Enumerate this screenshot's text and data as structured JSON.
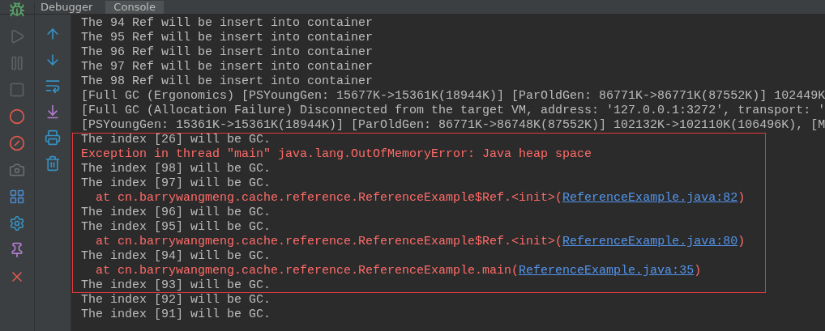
{
  "tabs": [
    {
      "label": "Debugger",
      "selected": false
    },
    {
      "label": "Console",
      "selected": true
    }
  ],
  "console": {
    "lines": [
      {
        "kind": "output",
        "text": "The 94 Ref will be insert into container"
      },
      {
        "kind": "output",
        "text": "The 95 Ref will be insert into container"
      },
      {
        "kind": "output",
        "text": "The 96 Ref will be insert into container"
      },
      {
        "kind": "output",
        "text": "The 97 Ref will be insert into container"
      },
      {
        "kind": "output",
        "text": "The 98 Ref will be insert into container"
      },
      {
        "kind": "output",
        "text": "[Full GC (Ergonomics) [PSYoungGen: 15677K->15361K(18944K)] [ParOldGen: 86771K->86771K(87552K)] 102449K"
      },
      {
        "kind": "output",
        "text": "[Full GC (Allocation Failure) Disconnected from the target VM, address: '127.0.0.1:3272', transport: '"
      },
      {
        "kind": "output",
        "text": "[PSYoungGen: 15361K->15361K(18944K)] [ParOldGen: 86771K->86748K(87552K)] 102132K->102110K(106496K), [M"
      },
      {
        "kind": "output",
        "text": "The index [26] will be GC."
      },
      {
        "kind": "error",
        "text": "Exception in thread \"main\" java.lang.OutOfMemoryError: Java heap space"
      },
      {
        "kind": "output",
        "text": "The index [98] will be GC."
      },
      {
        "kind": "output",
        "text": "The index [97] will be GC."
      },
      {
        "kind": "error",
        "text": "  at cn.barrywangmeng.cache.reference.ReferenceExample$Ref.<init>(",
        "link": "ReferenceExample.java:82",
        "after": ")"
      },
      {
        "kind": "output",
        "text": "The index [96] will be GC."
      },
      {
        "kind": "output",
        "text": "The index [95] will be GC."
      },
      {
        "kind": "error",
        "text": "  at cn.barrywangmeng.cache.reference.ReferenceExample$Ref.<init>(",
        "link": "ReferenceExample.java:80",
        "after": ")"
      },
      {
        "kind": "output",
        "text": "The index [94] will be GC."
      },
      {
        "kind": "error",
        "text": "  at cn.barrywangmeng.cache.reference.ReferenceExample.main(",
        "link": "ReferenceExample.java:35",
        "after": ")"
      },
      {
        "kind": "output",
        "text": "The index [93] will be GC."
      },
      {
        "kind": "output",
        "text": "The index [92] will be GC."
      },
      {
        "kind": "output",
        "text": "The index [91] will be GC."
      }
    ]
  }
}
